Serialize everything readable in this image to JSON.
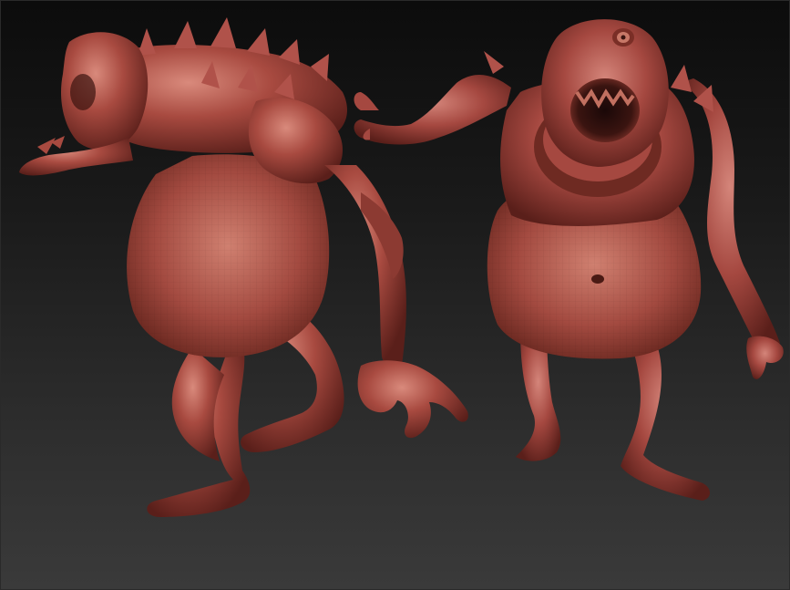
{
  "viewport": {
    "background_top": "#0c0c0c",
    "background_bottom": "#3a3a3a"
  },
  "models": [
    {
      "name": "hunched-monster-side-view",
      "view": "side",
      "material_color": "#a84a40"
    },
    {
      "name": "cyclops-monster-front-view",
      "view": "front",
      "material_color": "#a84a40"
    }
  ],
  "material": {
    "base": "#a84a40",
    "shadow": "#5a1f1a",
    "highlight": "#d0786a"
  }
}
